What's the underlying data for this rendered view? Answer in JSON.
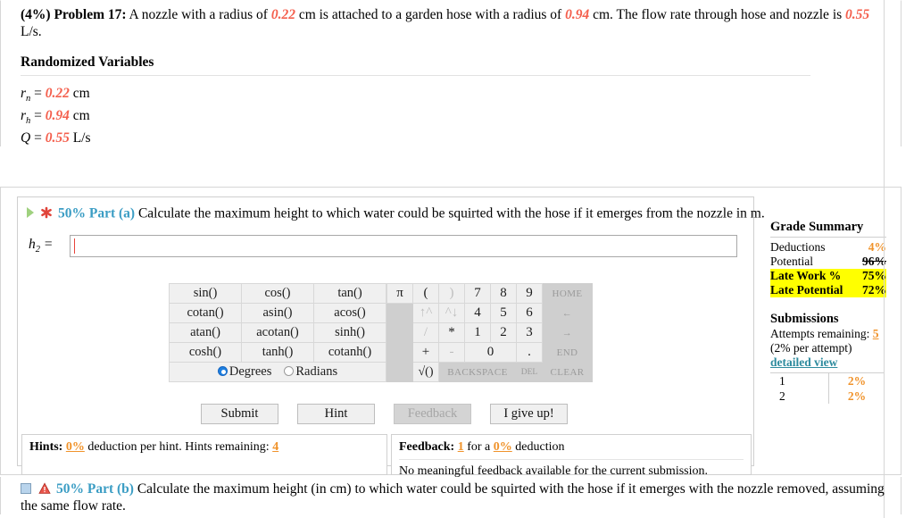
{
  "problem": {
    "weight": "(4%)",
    "label": "Problem 17:",
    "text_1": " A nozzle with a radius of ",
    "nozzle_radius": "0.22",
    "text_2": " cm is attached to a garden hose with a radius of ",
    "hose_radius": "0.94",
    "text_3": " cm. The flow rate through hose and nozzle is ",
    "flow_rate": "0.55",
    "text_4": " L/s."
  },
  "randomized": {
    "title": "Randomized Variables",
    "rows": [
      {
        "sym": "r",
        "sub": "n",
        "eq": " = ",
        "value": "0.22",
        "unit": " cm"
      },
      {
        "sym": "r",
        "sub": "h",
        "eq": " = ",
        "value": "0.94",
        "unit": " cm"
      },
      {
        "sym": "Q",
        "sub": "",
        "eq": " = ",
        "value": "0.55",
        "unit": " L/s"
      }
    ]
  },
  "part_a": {
    "percent": "50%",
    "label": " Part (a)",
    "prompt": " Calculate the maximum height to which water could be squirted with the hose if it emerges from the nozzle in m.",
    "answer_label_sym": "h",
    "answer_label_sub": "2",
    "answer_label_eq": " = ",
    "answer_value": "",
    "play_icon": "play-triangle-icon",
    "status_icon": "red-asterisk-icon"
  },
  "calculator": {
    "functions": [
      [
        "sin()",
        "cos()",
        "tan()"
      ],
      [
        "cotan()",
        "asin()",
        "acos()"
      ],
      [
        "atan()",
        "acotan()",
        "sinh()"
      ],
      [
        "cosh()",
        "tanh()",
        "cotanh()"
      ]
    ],
    "angle_mode": {
      "degrees": "Degrees",
      "radians": "Radians",
      "selected": "Degrees"
    },
    "keypad": [
      [
        "π",
        "(",
        ")",
        "7",
        "8",
        "9",
        "HOME"
      ],
      [
        "",
        "↑^",
        "^↓",
        "4",
        "5",
        "6",
        "←"
      ],
      [
        "",
        "/",
        "*",
        "1",
        "2",
        "3",
        "→"
      ],
      [
        "",
        "+",
        "-",
        "0",
        ".",
        "END"
      ],
      [
        "",
        "√()",
        "BACKSPACE",
        "DEL",
        "CLEAR"
      ]
    ]
  },
  "buttons": {
    "submit": "Submit",
    "hint": "Hint",
    "feedback": "Feedback",
    "give_up": "I give up!"
  },
  "hints": {
    "label": "Hints:",
    "deduction": "0%",
    "text_mid": " deduction per hint. Hints remaining: ",
    "remaining": "4"
  },
  "feedback": {
    "label": "Feedback:",
    "count": "1",
    "text_mid": " for a ",
    "deduction": "0%",
    "text_end": " deduction",
    "message": "No meaningful feedback available for the current submission."
  },
  "grade_summary": {
    "title": "Grade Summary",
    "rows": [
      {
        "name": "Deductions",
        "value": "4%",
        "style": "normal"
      },
      {
        "name": "Potential",
        "value": "96%",
        "style": "strike"
      },
      {
        "name": "Late Work %",
        "value": "75%",
        "style": "highlight"
      },
      {
        "name": "Late Potential",
        "value": "72%",
        "style": "highlight"
      }
    ]
  },
  "submissions": {
    "title": "Submissions",
    "attempts_label": "Attempts remaining: ",
    "attempts_value": "5",
    "per_attempt": "(2% per attempt)",
    "per_attempt_pct": "2%",
    "detailed_view": "detailed view",
    "rows": [
      {
        "n": "1",
        "p": "2%"
      },
      {
        "n": "2",
        "p": "2%"
      }
    ]
  },
  "part_b": {
    "percent": "50%",
    "label": " Part (b)",
    "prompt": " Calculate the maximum height (in cm) to which water could be squirted with the hose if it emerges with the nozzle removed, assuming the same flow rate.",
    "square_icon": "blue-square-icon",
    "warn_icon": "red-warning-triangle-icon"
  },
  "colors": {
    "value_red": "#f4604e",
    "accent_blue": "#3b9dc4",
    "orange": "#f0932b",
    "highlight": "#ffff00",
    "link_teal": "#2e8b9e"
  }
}
